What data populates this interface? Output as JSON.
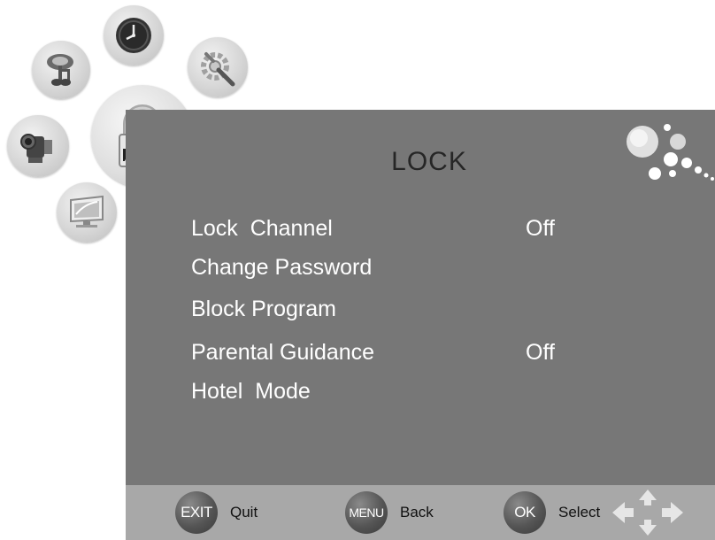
{
  "header": {
    "title": "LOCK"
  },
  "menu": {
    "items": [
      {
        "label": "Lock  Channel",
        "value": "Off"
      },
      {
        "label": "Change Password",
        "value": ""
      },
      {
        "label": "Block Program",
        "value": ""
      },
      {
        "label": "Parental Guidance",
        "value": "Off"
      },
      {
        "label": "Hotel  Mode",
        "value": ""
      }
    ]
  },
  "footer": {
    "exit": {
      "key": "EXIT",
      "label": "Quit"
    },
    "menu": {
      "key": "MENU",
      "label": "Back"
    },
    "ok": {
      "key": "OK",
      "label": "Select"
    }
  },
  "icons": {
    "categories": [
      "music-note-icon",
      "clock-icon",
      "settings-tools-icon",
      "camcorder-icon",
      "lock-icon",
      "monitor-icon"
    ],
    "nav": "directional-arrows-icon",
    "decoration": "bubble-dots-icon"
  },
  "colors": {
    "panel": "#777777",
    "footer": "#a8a8a8",
    "title": "#262626",
    "menu_text": "#ffffff"
  }
}
